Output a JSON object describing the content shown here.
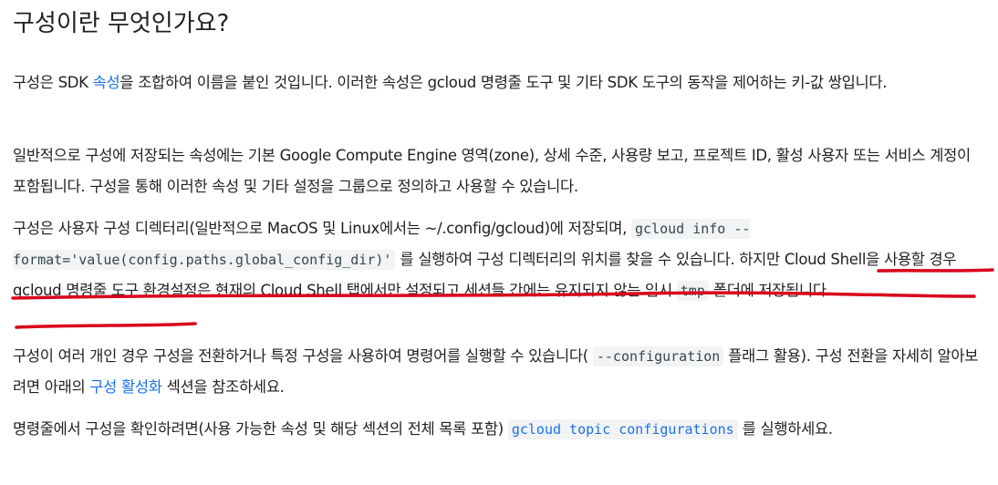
{
  "heading": "구성이란 무엇인가요?",
  "p1": {
    "t1": "구성은 SDK ",
    "link": "속성",
    "t2": "을 조합하여 이름을 붙인 것입니다. 이러한 속성은 gcloud 명령줄 도구 및 기타 SDK 도구의 동작을 제어하는 키-값 쌍입니다."
  },
  "p2": {
    "t1": "일반적으로 구성에 저장되는 속성에는 기본 Google Compute Engine 영역(zone), 상세 수준, 사용량 보고, 프로젝트 ID, 활성 사용자 또는 서비스 계정이 포함됩니다. 구성을 통해 이러한 속성 및 기타 설정을 그룹으로 정의하고 사용할 수 있습니다."
  },
  "p3": {
    "t1": "구성은 사용자 구성 디렉터리(일반적으로 MacOS 및 Linux에서는 ~/.config/gcloud)에 저장되며, ",
    "code1": "gcloud info --format='value(config.paths.global_config_dir)'",
    "t2": " 를 실행하여 구성 디렉터리의 위치를 찾을 수 있습니다. 하지만 Cloud Shell을 사용할 경우 gcloud 명령줄 도구 환경설정은 현재의 Cloud Shell 탭에서만 설정되고 세션들 간에는 유지되지 않는 임시 ",
    "code2": "tmp",
    "t3": " 폴더에 저장됩니다."
  },
  "p4": {
    "t1": "구성이 여러 개인 경우 구성을 전환하거나 특정 구성을 사용하여 명령어를 실행할 수 있습니다( ",
    "code1": "--configuration",
    "t2": " 플래그 활용). 구성 전환을 자세히 알아보려면 아래의 ",
    "link": "구성 활성화",
    "t3": " 섹션을 참조하세요."
  },
  "p5": {
    "t1": "명령줄에서 구성을 확인하려면(사용 가능한 속성 및 해당 섹션의 전체 목록 포함) ",
    "code1": "gcloud topic configurations",
    "t2": " 를 실행하세요."
  },
  "colors": {
    "link": "#1a73e8",
    "annotation": "#d9001b",
    "code_bg": "#f1f3f4"
  }
}
